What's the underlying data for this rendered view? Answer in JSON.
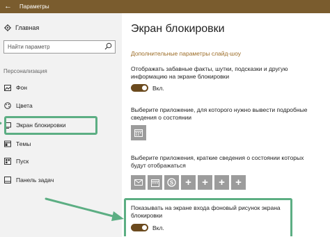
{
  "window": {
    "title": "Параметры",
    "back_glyph": "←",
    "titlebar_color": "#7a5c2e"
  },
  "sidebar": {
    "home_label": "Главная",
    "search_placeholder": "Найти параметр",
    "section_label": "Персонализация",
    "items": [
      {
        "label": "Фон",
        "icon": "image-icon"
      },
      {
        "label": "Цвета",
        "icon": "palette-icon"
      },
      {
        "label": "Экран блокировки",
        "icon": "monitor-icon"
      },
      {
        "label": "Темы",
        "icon": "brush-icon"
      },
      {
        "label": "Пуск",
        "icon": "start-icon"
      },
      {
        "label": "Панель задач",
        "icon": "taskbar-icon"
      }
    ]
  },
  "main": {
    "title": "Экран блокировки",
    "subheading": "Дополнительные параметры слайд-шоу",
    "fun_facts_text": "Отображать забавные факты, шутки, подсказки и другую информацию на экране блокировки",
    "fun_facts_toggle": "Вкл.",
    "detailed_app_text": "Выберите приложение, для которого нужно вывести подробные сведения о состоянии",
    "quick_apps_text": "Выберите приложения, краткие сведения о состоянии которых будут отображаться",
    "quick_app_tiles": [
      "mail-icon",
      "calendar-icon",
      "skype-icon",
      "add-icon",
      "add-icon",
      "add-icon",
      "add-icon"
    ],
    "plus_glyph": "+",
    "signin_bg_text": "Показывать на экране входа фоновый рисунок экрана блокировки",
    "signin_bg_toggle": "Вкл."
  },
  "colors": {
    "accent": "#9b6b25",
    "toggle_on": "#6b4a1e",
    "highlight": "#5cae83",
    "tile": "#9c9c9c"
  }
}
